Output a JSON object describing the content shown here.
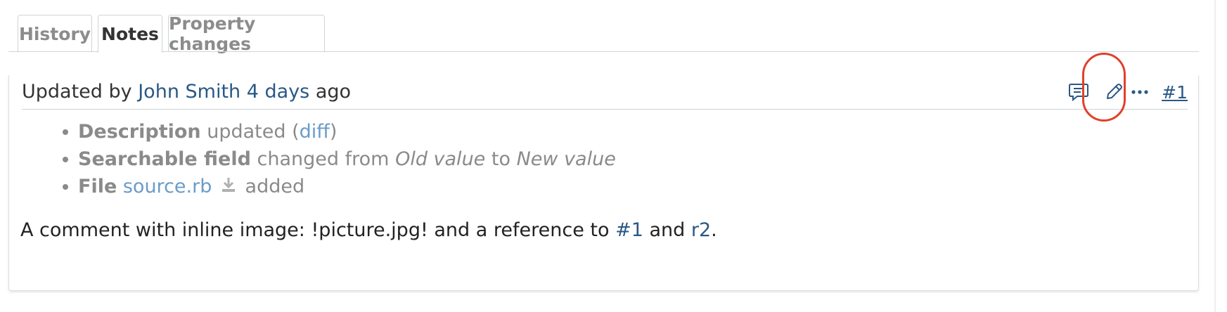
{
  "tabs": [
    {
      "label": "History"
    },
    {
      "label": "Notes",
      "selected": true
    },
    {
      "label": "Property changes"
    }
  ],
  "journal": {
    "prefix": "Updated by",
    "author": "John Smith",
    "time": "4 days",
    "suffix": "ago",
    "actions": {
      "quote_icon": "comment-icon",
      "edit_icon": "pencil-icon",
      "more_icon": "more-icon",
      "note_number": "#1"
    },
    "details": [
      {
        "field": "Description",
        "text": "updated (",
        "link": "diff",
        "text_after": ")"
      },
      {
        "field": "Searchable field",
        "text": "changed from",
        "old": "Old value",
        "to": "to",
        "new": "New value"
      },
      {
        "field": "File",
        "link": "source.rb",
        "icon": "download-icon",
        "text_after": "added"
      }
    ],
    "comment": {
      "text": "A comment with inline image: !picture.jpg! and a reference to ",
      "ref1": "#1",
      "and": " and ",
      "ref2": "r2",
      "end": "."
    }
  },
  "colors": {
    "link": "#2a5885",
    "highlight": "#e0412b",
    "muted_text": "#8a8a8a"
  }
}
